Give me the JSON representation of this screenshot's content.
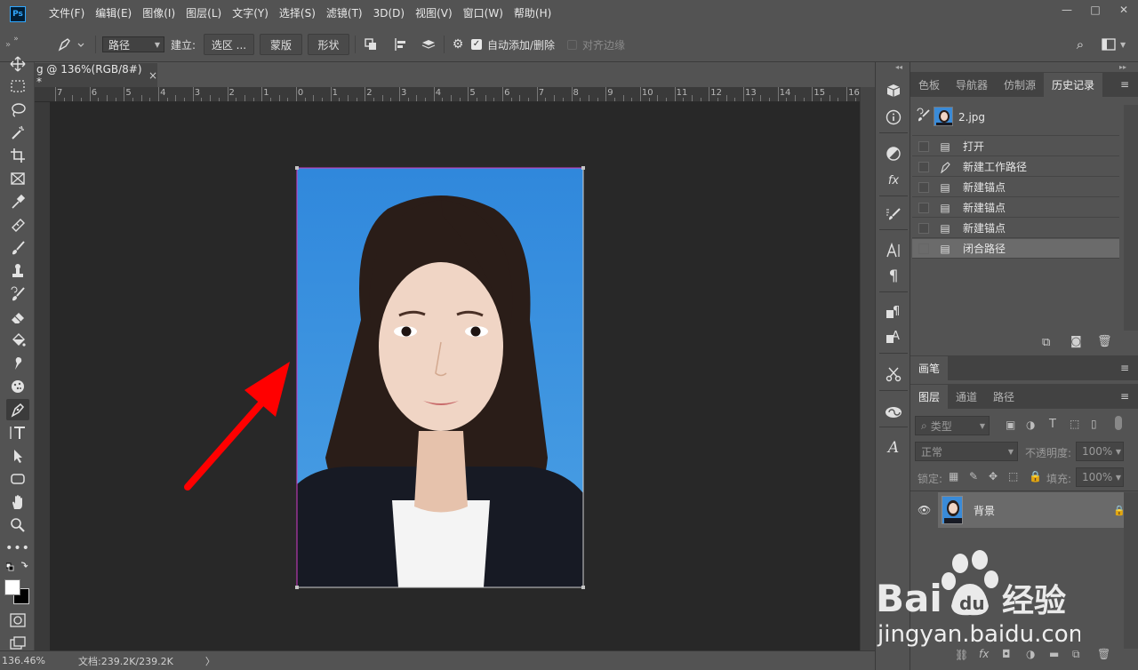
{
  "app": {
    "logo_text": "Ps"
  },
  "menu": [
    "文件(F)",
    "编辑(E)",
    "图像(I)",
    "图层(L)",
    "文字(Y)",
    "选择(S)",
    "滤镜(T)",
    "3D(D)",
    "视图(V)",
    "窗口(W)",
    "帮助(H)"
  ],
  "window_controls": {
    "minimize": "—",
    "maximize": "□",
    "close": "✕"
  },
  "options_bar": {
    "mode_value": "路径",
    "make_label": "建立:",
    "selection_button": "选区 ...",
    "mask_button": "蒙版",
    "shape_button": "形状",
    "auto_add_label": "自动添加/删除",
    "align_edges_label": "对齐边缘"
  },
  "document_tab": {
    "title": "g @ 136%(RGB/8#) *",
    "close": "×"
  },
  "ruler_labels": [
    "7",
    "6",
    "5",
    "4",
    "3",
    "2",
    "1",
    "0",
    "1",
    "2",
    "3",
    "4",
    "5",
    "6",
    "7",
    "8",
    "9",
    "10",
    "11",
    "12",
    "13",
    "14",
    "15",
    "16"
  ],
  "status": {
    "zoom": "136.46%",
    "doc_info": "文档:239.2K/239.2K",
    "arrow": "〉"
  },
  "history_panel": {
    "tabs": [
      "色板",
      "导航器",
      "仿制源",
      "历史记录"
    ],
    "active_tab": "历史记录",
    "snapshot_name": "2.jpg",
    "steps": [
      "打开",
      "新建工作路径",
      "新建锚点",
      "新建锚点",
      "新建锚点",
      "闭合路径"
    ],
    "selected_step": "闭合路径"
  },
  "brush_panel": {
    "tab": "画笔"
  },
  "layers_panel": {
    "tabs": [
      "图层",
      "通道",
      "路径"
    ],
    "active_tab": "图层",
    "filter_placeholder": "类型",
    "blend_mode": "正常",
    "opacity_label": "不透明度:",
    "opacity_value": "100%",
    "lock_label": "锁定:",
    "fill_label": "填充:",
    "fill_value": "100%",
    "layer_name": "背景"
  },
  "watermark": {
    "brand": "Bai",
    "brand2": "du",
    "cn": "经验",
    "url": "jingyan.baidu.com"
  },
  "colors": {
    "background": "#535353",
    "canvas": "#282828",
    "photo_bg": "#3b8fd9",
    "arrow": "#ff0000"
  }
}
